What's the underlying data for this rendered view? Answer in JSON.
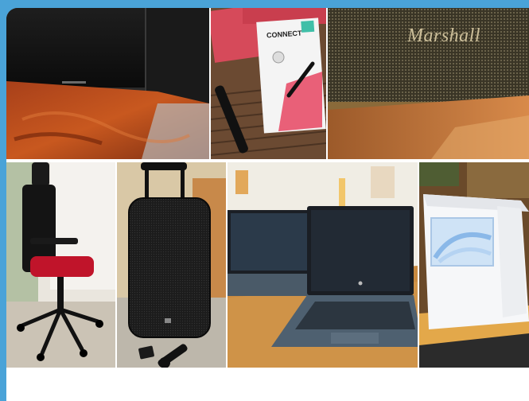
{
  "collage": {
    "tiles": [
      {
        "name": "speaker-on-wooden-desk-photo"
      },
      {
        "name": "connect-it-presenter-box-photo"
      },
      {
        "name": "marshall-speaker-photo",
        "brand_text": "Marshall"
      },
      {
        "name": "office-chair-photo"
      },
      {
        "name": "portable-party-speaker-photo"
      },
      {
        "name": "two-laptops-photo"
      },
      {
        "name": "imac-box-photo"
      }
    ],
    "connect_box_text": "CONNECT"
  },
  "colors": {
    "frame": "#4aa3d8",
    "card": "#ffffff"
  }
}
